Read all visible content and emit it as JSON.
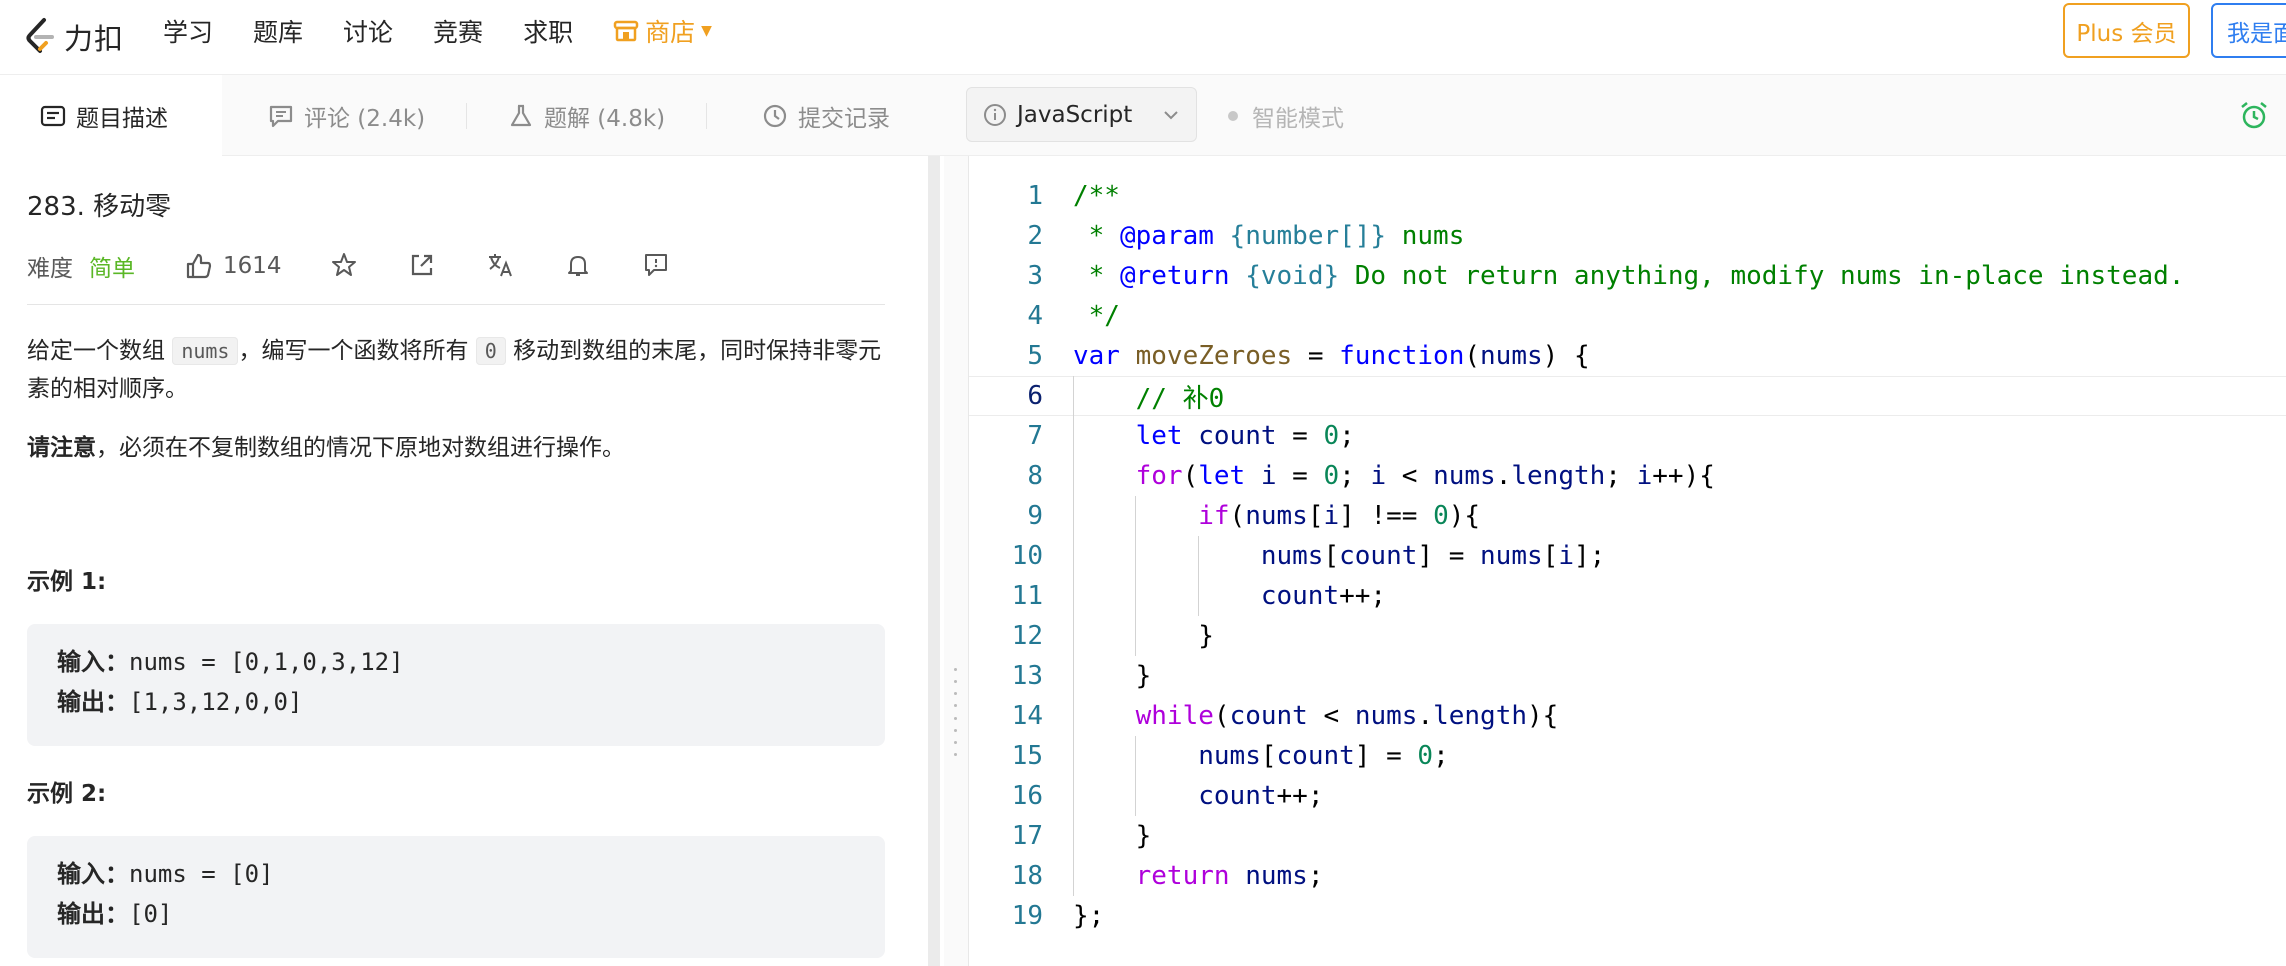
{
  "nav": {
    "logo_text": "力扣",
    "items": [
      "学习",
      "题库",
      "讨论",
      "竞赛",
      "求职"
    ],
    "shop_label": "商店",
    "plus_label": "Plus 会员",
    "interview_label": "我是面"
  },
  "tabs": [
    {
      "label": "题目描述",
      "icon": "description-icon"
    },
    {
      "label": "评论 (2.4k)",
      "icon": "comment-icon"
    },
    {
      "label": "题解 (4.8k)",
      "icon": "flask-icon"
    },
    {
      "label": "提交记录",
      "icon": "clock-icon"
    }
  ],
  "editor_toolbar": {
    "language": "JavaScript",
    "smart_mode": "智能模式"
  },
  "problem": {
    "title": "283. 移动零",
    "difficulty_label": "难度",
    "difficulty": "简单",
    "likes": "1614",
    "desc_1": "给定一个数组",
    "desc_code_1": "nums",
    "desc_2": "，编写一个函数将所有",
    "desc_code_2": "0",
    "desc_3": "移动到数组的末尾，同时保持非零元素的相对顺序。",
    "note_bold": "请注意",
    "note_rest": "，必须在不复制数组的情况下原地对数组进行操作。",
    "examples": [
      {
        "title": "示例 1:",
        "input_label": "输入：",
        "input": "nums = [0,1,0,3,12]",
        "output_label": "输出：",
        "output": "[1,3,12,0,0]"
      },
      {
        "title": "示例 2:",
        "input_label": "输入：",
        "input": "nums = [0]",
        "output_label": "输出：",
        "output": "[0]"
      }
    ]
  },
  "code": {
    "line_numbers": [
      "1",
      "2",
      "3",
      "4",
      "5",
      "6",
      "7",
      "8",
      "9",
      "10",
      "11",
      "12",
      "13",
      "14",
      "15",
      "16",
      "17",
      "18",
      "19"
    ],
    "current_line": "6",
    "lines": [
      "/**",
      " * @param {number[]} nums",
      " * @return {void} Do not return anything, modify nums in-place instead.",
      " */",
      "var moveZeroes = function(nums) {",
      "    // 补0",
      "    let count = 0;",
      "    for(let i = 0; i < nums.length; i++){",
      "        if(nums[i] !== 0){",
      "            nums[count] = nums[i];",
      "            count++;",
      "        }",
      "    }",
      "    while(count < nums.length){",
      "        nums[count] = 0;",
      "        count++;",
      "    }",
      "    return nums;",
      "};"
    ]
  },
  "colors": {
    "accent_orange": "#f0a020",
    "accent_blue": "#2f7ef0",
    "easy_green": "#5ab726",
    "line_number": "#237893"
  }
}
